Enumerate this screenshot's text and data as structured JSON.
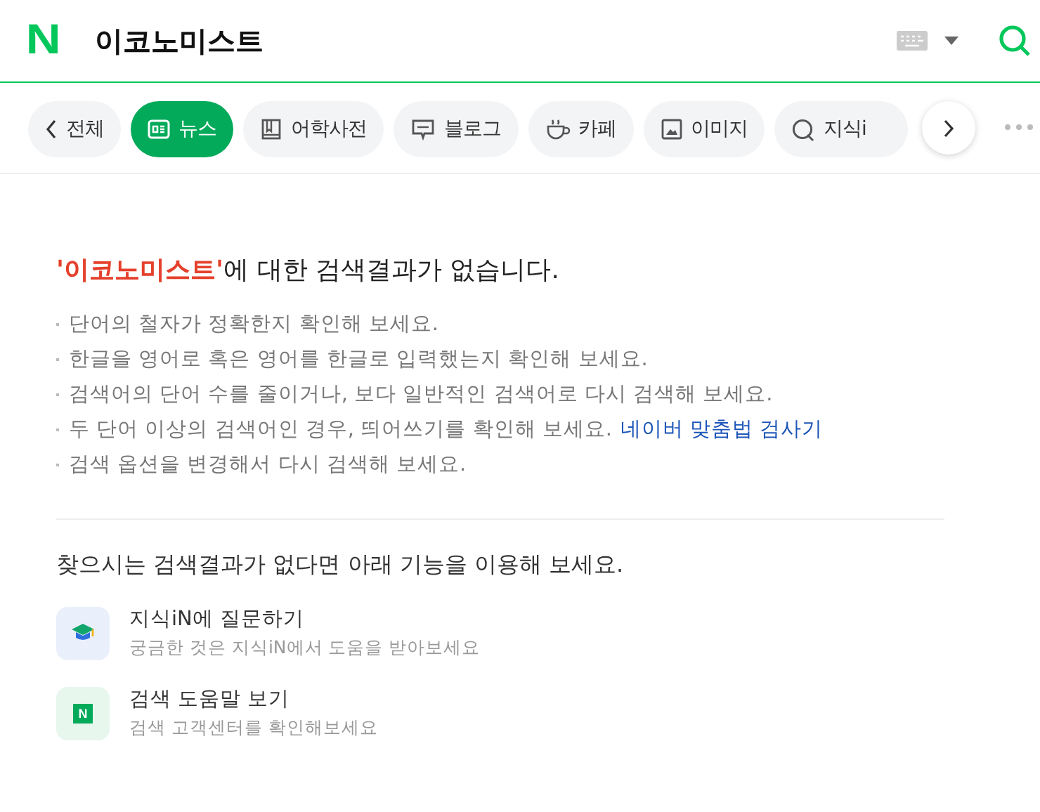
{
  "header": {
    "logo": "N",
    "query": "이코노미스트"
  },
  "tabs": [
    {
      "label": "전체",
      "kind": "back",
      "selected": false
    },
    {
      "label": "뉴스",
      "kind": "news",
      "selected": true
    },
    {
      "label": "어학사전",
      "kind": "dict",
      "selected": false
    },
    {
      "label": "블로그",
      "kind": "blog",
      "selected": false
    },
    {
      "label": "카페",
      "kind": "cafe",
      "selected": false
    },
    {
      "label": "이미지",
      "kind": "image",
      "selected": false
    },
    {
      "label": "지식i",
      "kind": "kin",
      "selected": false
    }
  ],
  "no_result": {
    "query": "'이코노미스트'",
    "message": "에 대한 검색결과가 없습니다.",
    "tips": [
      {
        "text": "단어의 철자가 정확한지 확인해 보세요."
      },
      {
        "text": "한글을 영어로 혹은 영어를 한글로 입력했는지 확인해 보세요."
      },
      {
        "text": "검색어의 단어 수를 줄이거나, 보다 일반적인 검색어로 다시 검색해 보세요."
      },
      {
        "text": "두 단어 이상의 검색어인 경우, 띄어쓰기를 확인해 보세요.",
        "link": "네이버 맞춤법 검사기"
      },
      {
        "text": "검색 옵션을 변경해서 다시 검색해 보세요."
      }
    ]
  },
  "help": {
    "title": "찾으시는 검색결과가 없다면 아래 기능을 이용해 보세요.",
    "items": [
      {
        "kind": "kin",
        "title": "지식iN에 질문하기",
        "subtitle": "궁금한 것은 지식iN에서 도움을 받아보세요"
      },
      {
        "kind": "help",
        "badge": "N",
        "title": "검색 도움말 보기",
        "subtitle": "검색 고객센터를 확인해보세요"
      }
    ]
  }
}
